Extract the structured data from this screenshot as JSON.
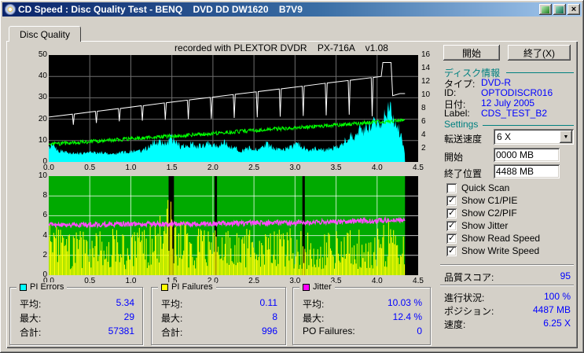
{
  "titlebar": {
    "title": "CD Speed : Disc Quality Test - BENQ    DVD DD DW1620    B7V9"
  },
  "tabs": [
    {
      "label": "Disc Quality"
    }
  ],
  "chart_header": "recorded with PLEXTOR DVDR    PX-716A    v1.08",
  "buttons": {
    "start": "開始",
    "exit": "終了(X)"
  },
  "disc_info": {
    "header": "ディスク情報",
    "rows": [
      {
        "label": "タイプ:",
        "value": "DVD-R"
      },
      {
        "label": "ID:",
        "value": "OPTODISCR016"
      },
      {
        "label": "日付:",
        "value": "12 July 2005"
      },
      {
        "label": "Label:",
        "value": "CDS_TEST_B2"
      }
    ]
  },
  "settings": {
    "header": "Settings",
    "speed_label": "転送速度",
    "speed_value": "6 X",
    "start_label": "開始",
    "start_value": "0000 MB",
    "end_label": "終了位置",
    "end_value": "4488 MB",
    "checkboxes": [
      {
        "label": "Quick Scan",
        "checked": false
      },
      {
        "label": "Show C1/PIE",
        "checked": true
      },
      {
        "label": "Show C2/PIF",
        "checked": true
      },
      {
        "label": "Show Jitter",
        "checked": true
      },
      {
        "label": "Show Read Speed",
        "checked": true
      },
      {
        "label": "Show Write Speed",
        "checked": true
      }
    ]
  },
  "quality": {
    "label": "品質スコア:",
    "value": "95"
  },
  "progress": {
    "rows": [
      {
        "label": "進行状況:",
        "value": "100 %"
      },
      {
        "label": "ポジション:",
        "value": "4487 MB"
      },
      {
        "label": "速度:",
        "value": "6.25 X"
      }
    ]
  },
  "stats_groups": [
    {
      "name": "PI Errors",
      "color": "#00ffff",
      "rows": [
        {
          "label": "平均:",
          "value": "5.34"
        },
        {
          "label": "最大:",
          "value": "29"
        },
        {
          "label": "合計:",
          "value": "57381"
        }
      ]
    },
    {
      "name": "PI Failures",
      "color": "#ffff00",
      "rows": [
        {
          "label": "平均:",
          "value": "0.11"
        },
        {
          "label": "最大:",
          "value": "8"
        },
        {
          "label": "合計:",
          "value": "996"
        }
      ]
    },
    {
      "name": "Jitter",
      "color": "#ff00ff",
      "rows": [
        {
          "label": "平均:",
          "value": "10.03 %"
        },
        {
          "label": "最大:",
          "value": "12.4 %"
        },
        {
          "label": "PO Failures:",
          "value": "0"
        }
      ]
    }
  ],
  "chart_data": [
    {
      "name": "pie-speed-chart",
      "type": "area",
      "title": "recorded with PLEXTOR DVDR PX-716A v1.08",
      "bg": "#000000",
      "grid_color": "#6e6e6e",
      "x_range": [
        0,
        4.5
      ],
      "x_ticks": [
        "0.0",
        "0.5",
        "1.0",
        "1.5",
        "2.0",
        "2.5",
        "3.0",
        "3.5",
        "4.0",
        "4.5"
      ],
      "grid_x": [
        0.5,
        1.0,
        1.5,
        2.0,
        2.5,
        3.0,
        3.5,
        4.0
      ],
      "y_left": {
        "range": [
          0,
          50
        ],
        "ticks": [
          50,
          40,
          30,
          20,
          10,
          0
        ]
      },
      "y_right": {
        "range": [
          0,
          16
        ],
        "ticks": [
          16,
          14,
          12,
          10,
          8,
          6,
          4,
          2
        ]
      },
      "grid_y": [
        10,
        20,
        30,
        40
      ],
      "series": [
        {
          "name": "PI Errors C1 PIE",
          "style": "area",
          "color": "#00ffff",
          "points": [
            [
              0,
              7
            ],
            [
              0.04,
              9
            ],
            [
              0.1,
              6
            ],
            [
              0.2,
              5
            ],
            [
              0.35,
              4.5
            ],
            [
              0.55,
              5
            ],
            [
              0.75,
              4.5
            ],
            [
              0.95,
              5
            ],
            [
              1.1,
              5.5
            ],
            [
              1.2,
              7
            ],
            [
              1.3,
              11
            ],
            [
              1.4,
              9
            ],
            [
              1.5,
              12
            ],
            [
              1.6,
              8
            ],
            [
              1.72,
              9
            ],
            [
              1.85,
              8
            ],
            [
              1.95,
              9.5
            ],
            [
              2.05,
              8
            ],
            [
              2.15,
              10
            ],
            [
              2.25,
              7
            ],
            [
              2.35,
              6
            ],
            [
              2.45,
              7
            ],
            [
              2.55,
              6
            ],
            [
              2.65,
              9
            ],
            [
              2.75,
              7
            ],
            [
              2.85,
              6
            ],
            [
              2.95,
              7.5
            ],
            [
              3.05,
              9
            ],
            [
              3.15,
              6
            ],
            [
              3.25,
              7
            ],
            [
              3.35,
              6
            ],
            [
              3.45,
              7
            ],
            [
              3.55,
              8.5
            ],
            [
              3.62,
              11
            ],
            [
              3.68,
              15
            ],
            [
              3.73,
              13
            ],
            [
              3.78,
              17
            ],
            [
              3.83,
              15
            ],
            [
              3.88,
              19
            ],
            [
              3.93,
              17
            ],
            [
              3.98,
              21
            ],
            [
              4.03,
              19
            ],
            [
              4.08,
              24
            ],
            [
              4.13,
              27
            ],
            [
              4.18,
              25
            ],
            [
              4.23,
              20
            ],
            [
              4.28,
              15
            ],
            [
              4.32,
              8
            ],
            [
              4.34,
              3
            ]
          ]
        },
        {
          "name": "Read Speed",
          "style": "noisy-line",
          "color": "#00ff00",
          "noise": 1.8,
          "points": [
            [
              0,
              8.2
            ],
            [
              4.34,
              19.5
            ]
          ]
        },
        {
          "name": "Write Speed",
          "style": "line",
          "color": "#ffffff",
          "points": [
            [
              0,
              21
            ],
            [
              0.288,
              22.35
            ],
            [
              0.3,
              17.4
            ],
            [
              0.312,
              22.4
            ],
            [
              0.568,
              23.66
            ],
            [
              0.58,
              18.2
            ],
            [
              0.592,
              23.7
            ],
            [
              0.848,
              24.97
            ],
            [
              0.86,
              19
            ],
            [
              0.872,
              25
            ],
            [
              1.128,
              26.29
            ],
            [
              1.14,
              19.3
            ],
            [
              1.152,
              26.3
            ],
            [
              1.408,
              27.6
            ],
            [
              1.42,
              19.7
            ],
            [
              1.432,
              27.7
            ],
            [
              1.688,
              28.9
            ],
            [
              1.7,
              20
            ],
            [
              1.712,
              29
            ],
            [
              1.968,
              30.2
            ],
            [
              1.98,
              20.3
            ],
            [
              1.992,
              30.3
            ],
            [
              2.248,
              31.5
            ],
            [
              2.26,
              20.6
            ],
            [
              2.272,
              31.6
            ],
            [
              2.528,
              32.8
            ],
            [
              2.54,
              20.9
            ],
            [
              2.552,
              32.9
            ],
            [
              2.808,
              34.1
            ],
            [
              2.82,
              21.2
            ],
            [
              2.832,
              34.2
            ],
            [
              3.088,
              35.4
            ],
            [
              3.1,
              21.5
            ],
            [
              3.112,
              35.5
            ],
            [
              3.368,
              36.8
            ],
            [
              3.38,
              21.8
            ],
            [
              3.392,
              36.9
            ],
            [
              3.648,
              38.1
            ],
            [
              3.66,
              22.1
            ],
            [
              3.672,
              38.2
            ],
            [
              3.928,
              39.4
            ],
            [
              3.94,
              21.4
            ],
            [
              3.952,
              39.5
            ],
            [
              4.05,
              40
            ],
            [
              4.07,
              46.5
            ],
            [
              4.17,
              46.5
            ],
            [
              4.19,
              31
            ],
            [
              4.28,
              32
            ],
            [
              4.34,
              32
            ]
          ]
        }
      ]
    },
    {
      "name": "pif-jitter-chart",
      "type": "spikes",
      "bg": "#000000",
      "grid_color": "rgba(255,255,255,0.75)",
      "x_range": [
        0,
        4.5
      ],
      "x_ticks": [
        "0.0",
        "0.5",
        "1.0",
        "1.5",
        "2.0",
        "2.5",
        "3.0",
        "3.5",
        "4.0",
        "4.5"
      ],
      "grid_x": [
        0.5,
        1.0,
        1.5,
        2.0,
        2.5,
        3.0,
        3.5,
        4.0
      ],
      "y_left": {
        "range": [
          0,
          10
        ],
        "ticks": [
          10,
          8,
          6,
          4,
          2,
          0
        ]
      },
      "grid_y": [
        2,
        4,
        6,
        8
      ],
      "series": [
        {
          "name": "C2 band",
          "style": "fill",
          "from": 0,
          "to": 4.34,
          "color": "#00aa00"
        },
        {
          "name": "dropouts",
          "style": "gaps",
          "color": "#000000",
          "ranges": [
            [
              1.46,
              1.525
            ],
            [
              2.02,
              2.05
            ],
            [
              3.09,
              3.12
            ]
          ]
        },
        {
          "name": "PI Failures C2 PIF",
          "style": "spikes",
          "color": "#ffff00",
          "points": [
            [
              0,
              7.5
            ],
            [
              0.06,
              6
            ],
            [
              0.15,
              4.5
            ],
            [
              0.4,
              4.5
            ],
            [
              0.7,
              4.8
            ],
            [
              1.0,
              4.5
            ],
            [
              1.25,
              5.5
            ],
            [
              1.4,
              6.5
            ],
            [
              1.45,
              8.5
            ],
            [
              1.55,
              6
            ],
            [
              1.8,
              4.8
            ],
            [
              2.1,
              4.5
            ],
            [
              2.4,
              4.8
            ],
            [
              2.7,
              4.5
            ],
            [
              3.0,
              4.8
            ],
            [
              3.3,
              4.5
            ],
            [
              3.6,
              4.8
            ],
            [
              3.9,
              5
            ],
            [
              4.1,
              5.5
            ],
            [
              4.2,
              6.5
            ],
            [
              4.3,
              5
            ],
            [
              4.34,
              4
            ]
          ]
        },
        {
          "name": "Jitter",
          "style": "noisy-line",
          "color": "#ff4cff",
          "noise": 0.5,
          "width": 1.4,
          "points": [
            [
              0,
              5.05
            ],
            [
              1,
              5.15
            ],
            [
              2,
              5.2
            ],
            [
              3,
              5.3
            ],
            [
              4,
              5.5
            ],
            [
              4.34,
              5.6
            ]
          ]
        }
      ]
    }
  ]
}
